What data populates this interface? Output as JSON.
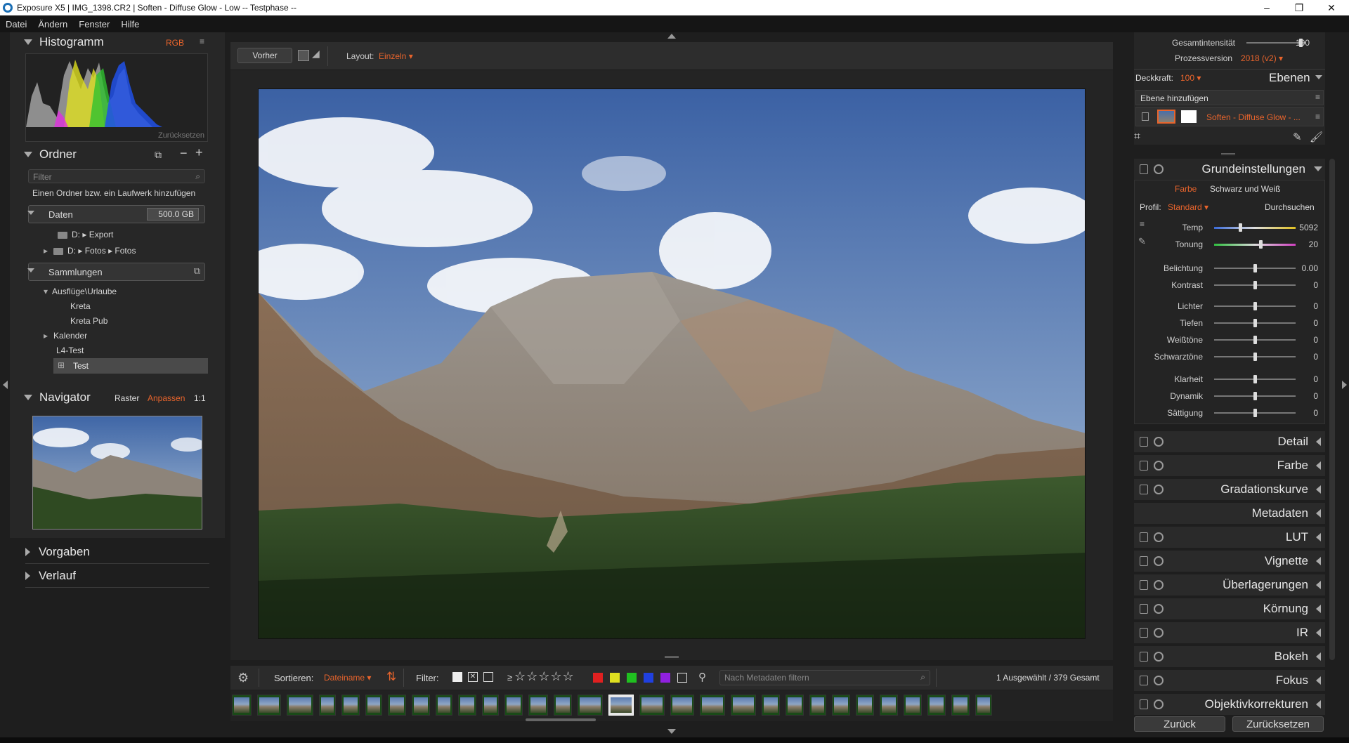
{
  "window": {
    "title": "Exposure X5 | IMG_1398.CR2 | Soften - Diffuse Glow - Low -- Testphase --",
    "min": "–",
    "max": "❐",
    "close": "✕"
  },
  "menu": [
    "Datei",
    "Ändern",
    "Fenster",
    "Hilfe"
  ],
  "left": {
    "histogram": {
      "title": "Histogramm",
      "mode": "RGB",
      "reset": "Zurücksetzen"
    },
    "folders": {
      "title": "Ordner",
      "filter_placeholder": "Filter",
      "add_hint": "Einen Ordner bzw. ein Laufwerk hinzufügen",
      "drive": {
        "name": "Daten",
        "size": "500.0 GB"
      },
      "items": [
        "D: ▸ Export",
        "D: ▸ Fotos ▸ Fotos"
      ],
      "collections_title": "Sammlungen",
      "collections": [
        "Ausflüge\\Urlaube",
        "Kreta",
        "Kreta Pub",
        "Kalender",
        "L4-Test",
        "Test"
      ]
    },
    "navigator": {
      "title": "Navigator",
      "raster": "Raster",
      "fit": "Anpassen",
      "one": "1:1"
    },
    "presets": "Vorgaben",
    "history": "Verlauf"
  },
  "toolbar": {
    "before": "Vorher",
    "layout_label": "Layout:",
    "layout_value": "Einzeln"
  },
  "filterbar": {
    "sort_label": "Sortieren:",
    "sort_value": "Dateiname",
    "filter_label": "Filter:",
    "rating_prefix": "≥",
    "stars": "☆☆☆☆☆",
    "search_placeholder": "Nach Metadaten filtern",
    "status": "1 Ausgewählt / 379 Gesamt"
  },
  "colors": {
    "accent": "#e8642c",
    "labels": [
      "#e02020",
      "#e0e020",
      "#20c020",
      "#2040e0",
      "#9020e0"
    ]
  },
  "right": {
    "intensity": {
      "label": "Gesamtintensität",
      "value": "100",
      "level": 0.92
    },
    "process": {
      "label": "Prozessversion",
      "value": "2018 (v2)"
    },
    "opacity": {
      "label": "Deckkraft:",
      "value": "100"
    },
    "layers": {
      "title": "Ebenen",
      "add": "Ebene hinzufügen",
      "layer_name": "Soften - Diffuse Glow - ..."
    },
    "basic": {
      "title": "Grundeinstellungen",
      "tab_color": "Farbe",
      "tab_bw": "Schwarz und Weiß",
      "profile_label": "Profil:",
      "profile_value": "Standard",
      "browse": "Durchsuchen",
      "sliders": [
        {
          "label": "Temp",
          "value": "5092",
          "level": 0.32
        },
        {
          "label": "Tonung",
          "value": "20",
          "level": 0.57
        },
        {
          "label": "Belichtung",
          "value": "0.00",
          "level": 0.5
        },
        {
          "label": "Kontrast",
          "value": "0",
          "level": 0.5
        },
        {
          "label": "Lichter",
          "value": "0",
          "level": 0.5
        },
        {
          "label": "Tiefen",
          "value": "0",
          "level": 0.5
        },
        {
          "label": "Weißtöne",
          "value": "0",
          "level": 0.5
        },
        {
          "label": "Schwarztöne",
          "value": "0",
          "level": 0.5
        },
        {
          "label": "Klarheit",
          "value": "0",
          "level": 0.5
        },
        {
          "label": "Dynamik",
          "value": "0",
          "level": 0.5
        },
        {
          "label": "Sättigung",
          "value": "0",
          "level": 0.5
        }
      ]
    },
    "panels": [
      "Detail",
      "Farbe",
      "Gradationskurve",
      "Metadaten",
      "LUT",
      "Vignette",
      "Überlagerungen",
      "Körnung",
      "IR",
      "Bokeh",
      "Fokus",
      "Objektivkorrekturen"
    ],
    "back": "Zurück",
    "reset": "Zurücksetzen"
  }
}
